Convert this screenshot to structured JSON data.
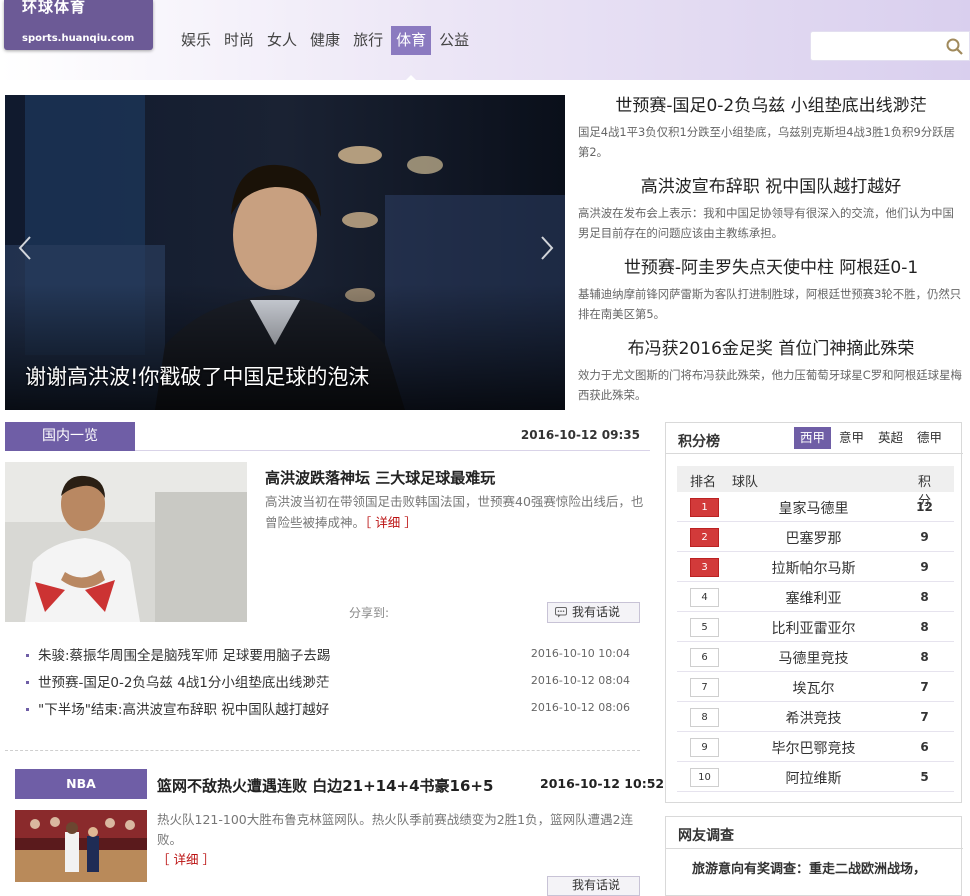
{
  "header": {
    "logo_text": "环球体育",
    "logo_url": "sports.huanqiu.com",
    "nav": [
      "娱乐",
      "时尚",
      "女人",
      "健康",
      "旅行",
      "体育",
      "公益"
    ],
    "nav_active": "体育",
    "search_placeholder": ""
  },
  "slideshow": {
    "caption": "谢谢高洪波!你戳破了中国足球的泡沫"
  },
  "headlines": [
    {
      "title": "世预赛-国足0-2负乌兹 小组垫底出线渺茫",
      "desc": "国足4战1平3负仅积1分跌至小组垫底，乌兹别克斯坦4战3胜1负积9分跃居第2。"
    },
    {
      "title": "高洪波宣布辞职 祝中国队越打越好",
      "desc": "高洪波在发布会上表示：我和中国足协领导有很深入的交流，他们认为中国男足目前存在的问题应该由主教练承担。"
    },
    {
      "title": "世预赛-阿圭罗失点天使中柱 阿根廷0-1",
      "desc": "基辅迪纳摩前锋冈萨雷斯为客队打进制胜球，阿根廷世预赛3轮不胜，仍然只排在南美区第5。"
    },
    {
      "title": "布冯获2016金足奖 首位门神摘此殊荣",
      "desc": "效力于尤文图斯的门将布冯获此殊荣，他力压葡萄牙球星C罗和阿根廷球星梅西获此殊荣。"
    }
  ],
  "domestic": {
    "tab": "国内一览",
    "date": "2016-10-12 09:35",
    "feature": {
      "title": "高洪波跌落神坛 三大球足球最难玩",
      "desc": "高洪波当初在带领国足击败韩国法国，世预赛40强赛惊险出线后，也曾险些被捧成神。",
      "more": "［ 详细 ］",
      "share": "分享到:",
      "comment": "我有话说"
    },
    "news": [
      {
        "title": "朱骏:蔡振华周围全是脑残军师 足球要用脑子去踢",
        "time": "2016-10-10 10:04"
      },
      {
        "title": "世预赛-国足0-2负乌兹 4战1分小组垫底出线渺茫",
        "time": "2016-10-12 08:04"
      },
      {
        "title": "\"下半场\"结束:高洪波宣布辞职 祝中国队越打越好",
        "time": "2016-10-12 08:06"
      }
    ]
  },
  "nba": {
    "tab": "NBA",
    "title": "篮网不敌热火遭遇连败 白边21+14+4书豪16+5",
    "date": "2016-10-12 10:52",
    "desc": "热火队121-100大胜布鲁克林篮网队。热火队季前赛战绩变为2胜1负，篮网队遭遇2连败。",
    "more": "［ 详细 ］",
    "comment": "我有话说"
  },
  "standings": {
    "title": "积分榜",
    "tabs": [
      "西甲",
      "意甲",
      "英超",
      "德甲"
    ],
    "tab_active": "西甲",
    "columns": {
      "rank": "排名",
      "team": "球队",
      "points": "积分"
    },
    "rows": [
      {
        "rank": "1",
        "team": "皇家马德里",
        "points": "12"
      },
      {
        "rank": "2",
        "team": "巴塞罗那",
        "points": "9"
      },
      {
        "rank": "3",
        "team": "拉斯帕尔马斯",
        "points": "9"
      },
      {
        "rank": "4",
        "team": "塞维利亚",
        "points": "8"
      },
      {
        "rank": "5",
        "team": "比利亚雷亚尔",
        "points": "8"
      },
      {
        "rank": "6",
        "team": "马德里竞技",
        "points": "8"
      },
      {
        "rank": "7",
        "team": "埃瓦尔",
        "points": "7"
      },
      {
        "rank": "8",
        "team": "希洪竞技",
        "points": "7"
      },
      {
        "rank": "9",
        "team": "毕尔巴鄂竞技",
        "points": "6"
      },
      {
        "rank": "10",
        "team": "阿拉维斯",
        "points": "5"
      }
    ]
  },
  "poll": {
    "title": "网友调查",
    "question": "旅游意向有奖调查：重走二战欧洲战场，"
  },
  "colors": {
    "accent": "#6f5ea6",
    "rank_top": "#d23a3a"
  }
}
